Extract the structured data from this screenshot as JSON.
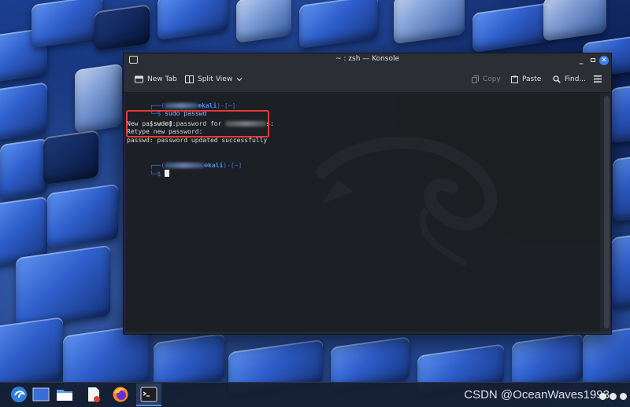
{
  "window": {
    "title": "~ : zsh — Konsole",
    "min_glyph": "_",
    "close_glyph": "✕"
  },
  "toolbar": {
    "new_tab_label": "New Tab",
    "split_view_label": "Split View",
    "copy_label": "Copy",
    "paste_label": "Paste",
    "find_label": "Find..."
  },
  "terminal": {
    "prompt1": {
      "frame_open": "┌──(",
      "host": "kali",
      "frame_close": ")-[~]",
      "prompt_prefix": "└─$",
      "command": "sudo passwd"
    },
    "output": {
      "sudo_prefix": "[sudo] password for ",
      "sudo_suffix": "s:",
      "new_password": "New password:",
      "retype_password": "Retype new password:",
      "result": "passwd: password updated successfully"
    },
    "prompt2": {
      "frame_open": "┌──(",
      "host": "kali",
      "frame_close": ")-[~]",
      "prompt_prefix": "└─$"
    }
  },
  "taskbar": {
    "watermark": "CSDN @OceanWaves1993",
    "icons": [
      "kde-launcher-icon",
      "desktop-pager-icon",
      "file-manager-icon",
      "text-editor-icon",
      "firefox-icon",
      "konsole-icon"
    ]
  },
  "colors": {
    "accent": "#3d7ff0",
    "highlight_border": "#e43a36",
    "prompt_blue": "#3e7be8"
  }
}
